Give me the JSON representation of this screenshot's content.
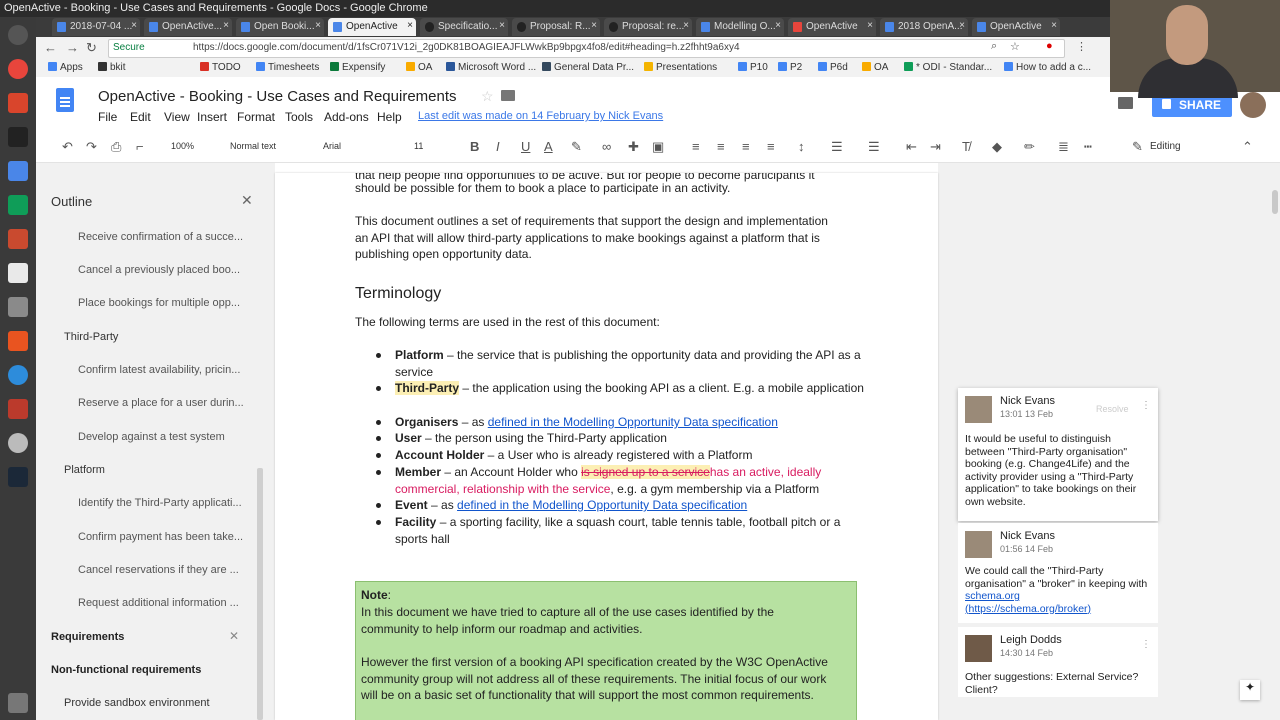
{
  "os": {
    "window_title": "OpenActive - Booking - Use Cases and Requirements - Google Docs - Google Chrome"
  },
  "browser": {
    "tabs": [
      {
        "label": "2018-07-04 ..."
      },
      {
        "label": "OpenActive..."
      },
      {
        "label": "Open Booki..."
      },
      {
        "label": "OpenActive",
        "active": true
      },
      {
        "label": "Specificatio..."
      },
      {
        "label": "Proposal: R..."
      },
      {
        "label": "Proposal: re..."
      },
      {
        "label": "Modelling O..."
      },
      {
        "label": "OpenActive"
      },
      {
        "label": "2018 OpenA..."
      },
      {
        "label": "OpenActive"
      }
    ],
    "secure_label": "Secure",
    "url": "https://docs.google.com/document/d/1fsCr071V12i_2g0DK81BOAGIEAJFLWwkBp9bpgx4fo8/edit#heading=h.z2fhht9a6xy4",
    "bookmarks": [
      {
        "label": "Apps",
        "color": "#4285f4"
      },
      {
        "label": "bkit",
        "color": "#333333"
      },
      {
        "label": "TODO",
        "color": "#d93025"
      },
      {
        "label": "Timesheets",
        "color": "#4285f4"
      },
      {
        "label": "Expensify",
        "color": "#0b7a3b"
      },
      {
        "label": "OA",
        "color": "#f9ab00"
      },
      {
        "label": "Microsoft Word ...",
        "color": "#2b579a"
      },
      {
        "label": "General Data Pr...",
        "color": "#34495e"
      },
      {
        "label": "Presentations",
        "color": "#f4b400"
      },
      {
        "label": "P10",
        "color": "#4285f4"
      },
      {
        "label": "P2",
        "color": "#4285f4"
      },
      {
        "label": "P6d",
        "color": "#4285f4"
      },
      {
        "label": "OA",
        "color": "#f9ab00"
      },
      {
        "label": "* ODI - Standar...",
        "color": "#0f9d58"
      },
      {
        "label": "How to add a c...",
        "color": "#4285f4"
      }
    ]
  },
  "docs": {
    "title": "OpenActive - Booking - Use Cases and Requirements",
    "menus": [
      "File",
      "Edit",
      "View",
      "Insert",
      "Format",
      "Tools",
      "Add-ons",
      "Help"
    ],
    "last_edit": "Last edit was made on 14 February by Nick Evans",
    "share_label": "SHARE",
    "toolbar": {
      "zoom": "100%",
      "style": "Normal text",
      "font": "Arial",
      "size": "11",
      "mode": "Editing"
    }
  },
  "outline": {
    "title": "Outline",
    "items": [
      {
        "label": "Receive confirmation of a succe...",
        "level": 3
      },
      {
        "label": "Cancel a previously placed boo...",
        "level": 3
      },
      {
        "label": "Place bookings for multiple opp...",
        "level": 3
      },
      {
        "label": "Third-Party",
        "level": 2
      },
      {
        "label": "Confirm latest availability, pricin...",
        "level": 3
      },
      {
        "label": "Reserve a place for a user durin...",
        "level": 3
      },
      {
        "label": "Develop against a test system",
        "level": 3
      },
      {
        "label": "Platform",
        "level": 2
      },
      {
        "label": "Identify the Third-Party applicati...",
        "level": 3
      },
      {
        "label": "Confirm payment has been take...",
        "level": 3
      },
      {
        "label": "Cancel reservations if they are ...",
        "level": 3
      },
      {
        "label": "Request additional information ...",
        "level": 3
      },
      {
        "label": "Requirements",
        "level": 1
      },
      {
        "label": "Non-functional requirements",
        "level": 1
      },
      {
        "label": "Provide sandbox environment",
        "level": 2
      }
    ]
  },
  "document": {
    "intro_line1": "that help people find opportunities to be active. But for people to become participants it",
    "intro_line2": "should be possible for them to book a place to participate in an activity.",
    "para_line1": "This document outlines a set of requirements that support the design and implementation",
    "para_line2": "an API that will allow third-party applications to make bookings against a platform that is",
    "para_line3": "publishing open opportunity data.",
    "heading": "Terminology",
    "terms_intro": "The following terms are used in the rest of this document:",
    "terms": {
      "platform_term": "Platform",
      "platform_def": " – the service that is publishing the opportunity data and providing the API as a service",
      "thirdparty_term": "Third-Party",
      "thirdparty_def": " – the application using the booking API as a client. E.g. a mobile application",
      "organisers_term": "Organisers",
      "organisers_pre": " – as ",
      "organisers_link": "defined in the Modelling Opportunity Data specification",
      "user_term": "User",
      "user_def": " – the person using the Third-Party application",
      "holder_term": "Account Holder",
      "holder_def": " – a User who is already registered with a Platform",
      "member_term": "Member",
      "member_pre": " – an Account Holder who ",
      "member_deleted": "is signed up to a service",
      "member_inserted": "has an active, ideally commercial, relationship with the service",
      "member_post": ", e.g. a gym membership via a Platform",
      "event_term": "Event",
      "event_pre": " – as ",
      "event_link": "defined in the Modelling Opportunity Data specification",
      "facility_term": "Facility",
      "facility_def": " – a sporting facility, like a squash court, table tennis table, football pitch or a sports hall"
    },
    "note": {
      "label": "Note",
      "colon": ":",
      "line1": "In this document we have tried to capture all of the use cases identified by the",
      "line2": "community to help inform our roadmap and activities.",
      "line3": "However the first version of a booking API specification created by the W3C OpenActive",
      "line4": "community group will not address all of these requirements. The initial focus of our work",
      "line5": "will be on a basic set of functionality that will support the most common requirements."
    }
  },
  "comments": [
    {
      "author": "Nick Evans",
      "time": "13:01 13 Feb",
      "resolve": "Resolve",
      "text": "It would be useful to distinguish between \"Third-Party organisation\" booking (e.g. Change4Life) and the activity provider using a \"Third-Party application\" to take bookings on their own website."
    },
    {
      "author": "Nick Evans",
      "time": "01:56 14 Feb",
      "text_pre": "We could call the \"Third-Party organisation\" a \"broker\" in keeping with ",
      "link": "schema.org",
      "link2": "(https://schema.org/broker)"
    },
    {
      "author": "Leigh Dodds",
      "time": "14:30 14 Feb",
      "text": "Other suggestions: External Service? Client?"
    }
  ]
}
